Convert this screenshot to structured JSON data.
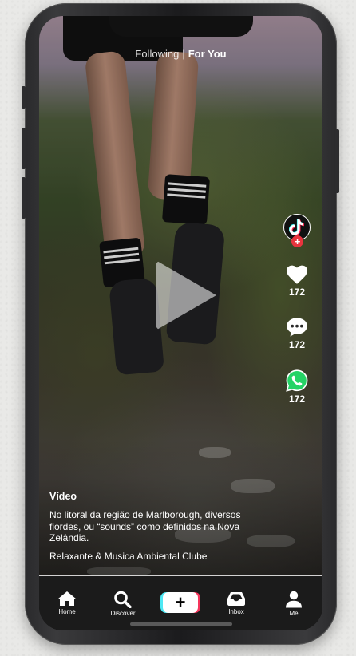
{
  "top_tabs": {
    "following": "Following",
    "separator": "|",
    "for_you": "For You"
  },
  "actions": {
    "like": {
      "icon": "heart-icon",
      "count": "172"
    },
    "comment": {
      "icon": "comment-icon",
      "count": "172"
    },
    "share": {
      "icon": "whatsapp-icon",
      "count": "172"
    }
  },
  "caption": {
    "title": "Vídeo",
    "description": "No litoral da região de Marlborough, diversos fiordes, ou “sounds” como definidos na Nova Zelândia.",
    "music": "Relaxante & Musica Ambiental Clube"
  },
  "nav": {
    "home": "Home",
    "discover": "Discover",
    "create": "+",
    "inbox": "Inbox",
    "me": "Me"
  },
  "colors": {
    "badge": "#e8343e",
    "create_cyan": "#4de8f4",
    "create_red": "#f6355b",
    "whatsapp": "#25d366"
  }
}
